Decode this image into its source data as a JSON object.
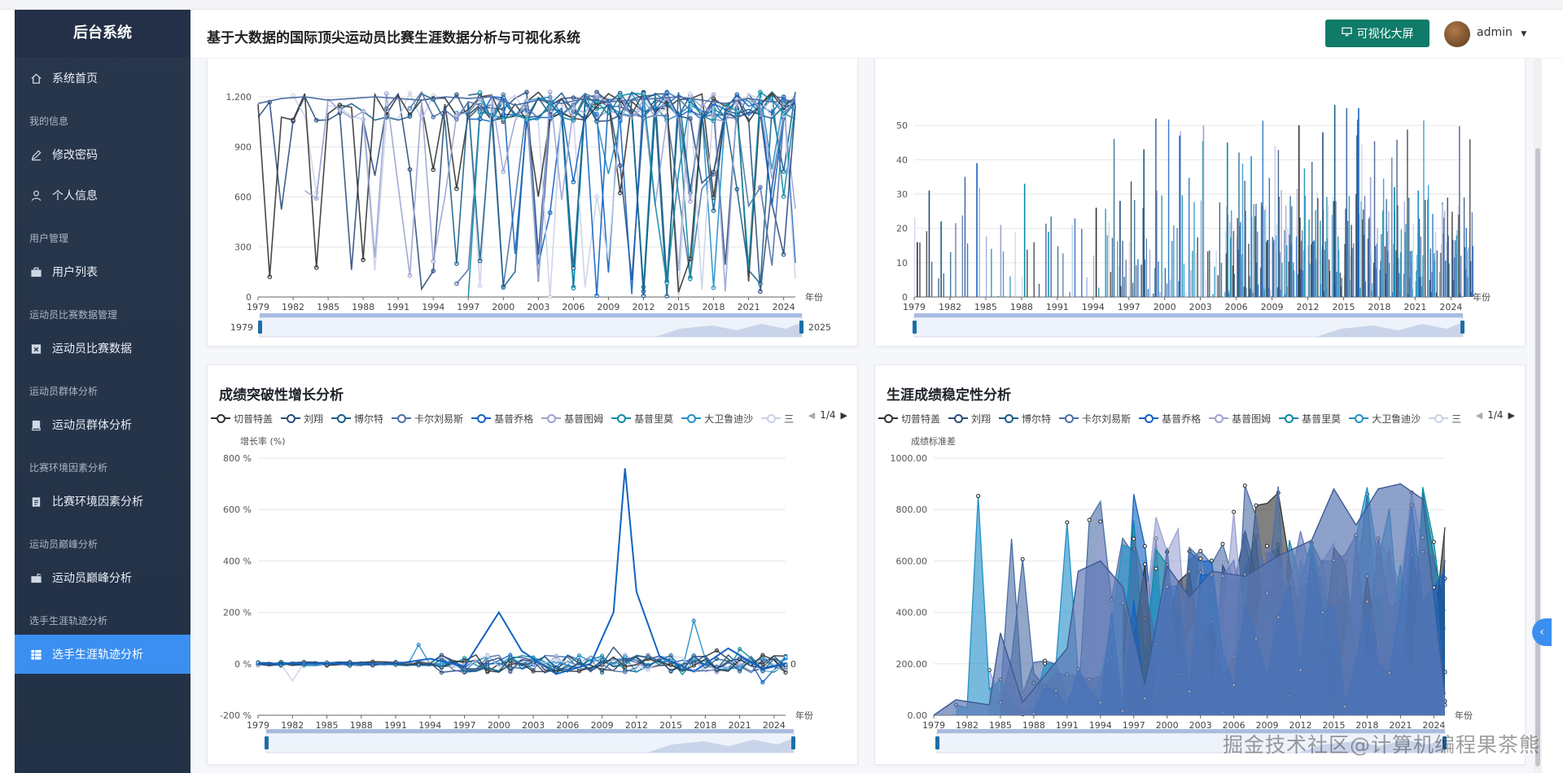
{
  "sidebar": {
    "brand": "后台系统",
    "home": "系统首页",
    "groups": {
      "my_info": "我的信息",
      "user_mgmt": "用户管理",
      "match_data_mgmt": "运动员比赛数据管理",
      "group_analysis": "运动员群体分析",
      "env_analysis": "比赛环境因素分析",
      "peak_analysis": "运动员巅峰分析",
      "career_analysis": "选手生涯轨迹分析"
    },
    "items": {
      "change_password": "修改密码",
      "profile": "个人信息",
      "user_list": "用户列表",
      "match_data": "运动员比赛数据",
      "group": "运动员群体分析",
      "env": "比赛环境因素分析",
      "peak": "运动员巅峰分析",
      "career": "选手生涯轨迹分析"
    }
  },
  "header": {
    "title": "基于大数据的国际顶尖运动员比赛生涯数据分析与可视化系统",
    "screen_button": "可视化大屏",
    "user": "admin"
  },
  "colors": {
    "sidebar_bg": "#29374d",
    "active_item": "#3b8ff0",
    "screen_button": "#0f7b68",
    "series": [
      "#333333",
      "#2b4c7e",
      "#1a5e8a",
      "#4d6fa6",
      "#1363c2",
      "#9aa3d2",
      "#0d8aa6",
      "#2390c8",
      "#c9d2e8"
    ]
  },
  "legend": {
    "items": [
      "切普特盖",
      "刘翔",
      "博尔特",
      "卡尔刘易斯",
      "基普乔格",
      "基普图姆",
      "基普里莫",
      "大卫鲁迪沙",
      "三"
    ],
    "page": "1/4"
  },
  "watermark": "掘金技术社区@计算机编程果茶熊",
  "chart_data": [
    {
      "type": "line",
      "title": "",
      "x_ticks": [
        "1979",
        "1982",
        "1985",
        "1988",
        "1991",
        "1994",
        "1997",
        "2000",
        "2003",
        "2006",
        "2009",
        "2012",
        "2015",
        "2018",
        "2021",
        "2024"
      ],
      "x_unit": "年份",
      "y_ticks": [
        "0",
        "300",
        "600",
        "900",
        "1,200"
      ],
      "ylim": [
        0,
        1200
      ],
      "zoom_range": [
        "1979",
        "2025"
      ],
      "sample_series": {
        "x": [
          1979,
          1981,
          1983,
          1985,
          1987,
          1989,
          1991,
          1993,
          1995,
          1997,
          1999,
          2001,
          2003,
          2005,
          2007,
          2009,
          2011,
          2013,
          2015,
          2017,
          2019,
          2021,
          2023,
          2025
        ],
        "y": [
          1160,
          1190,
          1200,
          1180,
          1190,
          1200,
          1190,
          1180,
          1200,
          1190,
          1200,
          1150,
          1180,
          1160,
          1190,
          1170,
          1180,
          1190,
          1200,
          1180,
          1160,
          1190,
          1170,
          1180
        ]
      }
    },
    {
      "type": "bar",
      "title": "",
      "x_ticks": [
        "1979",
        "1982",
        "1985",
        "1988",
        "1991",
        "1994",
        "1997",
        "2000",
        "2003",
        "2006",
        "2009",
        "2012",
        "2015",
        "2018",
        "2021",
        "2024"
      ],
      "x_unit": "年份",
      "y_ticks": [
        "0",
        "10",
        "20",
        "30",
        "40",
        "50"
      ],
      "ylim": [
        0,
        55
      ],
      "sample_values": {
        "x": [
          1979,
          1980,
          1981,
          1983,
          1984,
          1986,
          1988,
          1990,
          1992,
          1994,
          1996,
          1998,
          1999,
          2001,
          2003,
          2005,
          2007,
          2009,
          2011,
          2013,
          2014,
          2015,
          2016,
          2017,
          2019,
          2021,
          2023
        ],
        "y": [
          16,
          31,
          22,
          35,
          39,
          21,
          33,
          19,
          21,
          26,
          28,
          43,
          52,
          47,
          50,
          45,
          41,
          44,
          50,
          48,
          56,
          55,
          55,
          35,
          32,
          31,
          27
        ]
      }
    },
    {
      "type": "line",
      "title": "成绩突破性增长分析",
      "ylabel": "增长率 (%)",
      "x_ticks": [
        "1979",
        "1982",
        "1985",
        "1988",
        "1991",
        "1994",
        "1997",
        "2000",
        "2003",
        "2006",
        "2009",
        "2012",
        "2015",
        "2018",
        "2021",
        "2024"
      ],
      "y_ticks": [
        "-200 %",
        "0 %",
        "200 %",
        "400 %",
        "600 %",
        "800 %"
      ],
      "ylim": [
        -200,
        800
      ],
      "x_unit": "年份",
      "end_label": "0",
      "sample_series": {
        "x": [
          1979,
          1985,
          1991,
          1994,
          1997,
          2000,
          2002,
          2005,
          2008,
          2010,
          2011,
          2012,
          2014,
          2017,
          2020,
          2023,
          2025
        ],
        "y": [
          0,
          0,
          0,
          20,
          -10,
          200,
          50,
          -40,
          0,
          200,
          760,
          280,
          30,
          -30,
          60,
          -20,
          0
        ]
      }
    },
    {
      "type": "area",
      "title": "生涯成绩稳定性分析",
      "ylabel": "成绩标准差",
      "x_ticks": [
        "1979",
        "1982",
        "1985",
        "1988",
        "1991",
        "1994",
        "1997",
        "2000",
        "2003",
        "2006",
        "2009",
        "2012",
        "2015",
        "2018",
        "2021",
        "2024"
      ],
      "y_ticks": [
        "0.00",
        "200.00",
        "400.00",
        "600.00",
        "800.00",
        "1000.00"
      ],
      "ylim": [
        0,
        1000
      ],
      "x_unit": "年份",
      "sample_series": {
        "x": [
          1979,
          1981,
          1984,
          1985,
          1987,
          1991,
          1992,
          1994,
          1996,
          1998,
          2000,
          2002,
          2004,
          2007,
          2010,
          2013,
          2015,
          2017,
          2019,
          2021,
          2023,
          2025
        ],
        "y": [
          0,
          60,
          40,
          320,
          50,
          260,
          560,
          600,
          500,
          120,
          580,
          460,
          560,
          540,
          620,
          680,
          880,
          740,
          880,
          900,
          840,
          80
        ]
      }
    }
  ]
}
